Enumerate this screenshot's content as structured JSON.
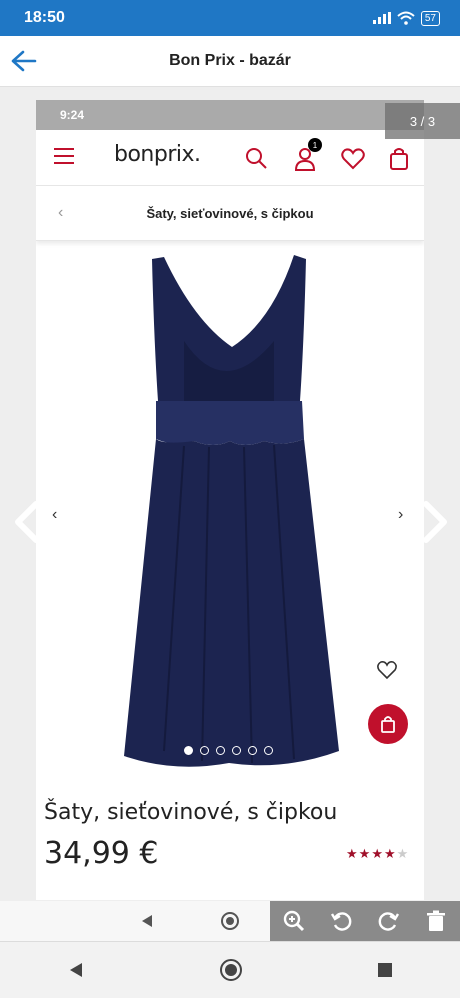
{
  "status_bar": {
    "time": "18:50",
    "battery": "57"
  },
  "app_bar": {
    "title": "Bon Prix - bazár"
  },
  "viewer": {
    "counter": "3 / 3"
  },
  "screenshot": {
    "status_time": "9:24",
    "shop": {
      "logo": "bonprix.",
      "cart_badge": "1",
      "breadcrumb": "Šaty, sieťovinové, s čipkou",
      "product_name": "Šaty, sieťovinové, s čipkou",
      "price": "34,99 €",
      "rating": 4,
      "rating_max": 5,
      "image_dots": 6,
      "active_dot": 0
    }
  },
  "colors": {
    "brand_red": "#c0102c",
    "status_blue": "#1f77c5",
    "dress_navy": "#1c2450"
  },
  "icons": [
    "back-arrow-icon",
    "hamburger-icon",
    "search-icon",
    "user-icon",
    "heart-icon",
    "bag-icon",
    "chevron-left-icon",
    "chevron-right-icon",
    "zoom-icon",
    "rotate-left-icon",
    "rotate-right-icon",
    "trash-icon",
    "nav-back-icon",
    "nav-home-icon",
    "nav-recents-icon"
  ]
}
